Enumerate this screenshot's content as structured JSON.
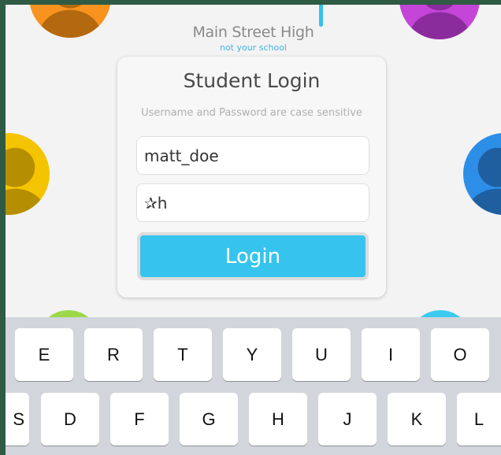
{
  "school": {
    "name": "Main Street High",
    "tagline": "not your school"
  },
  "login": {
    "title": "Student Login",
    "hint": "Username and Password are case sensitive",
    "username_value": "matt_doe",
    "password_value": "✰h",
    "button_label": "Login"
  },
  "keyboard": {
    "row1": [
      "E",
      "R",
      "T",
      "Y",
      "U",
      "I",
      "O"
    ],
    "row2": [
      "S",
      "D",
      "F",
      "G",
      "H",
      "J",
      "K",
      "L"
    ]
  },
  "colors": {
    "accent": "#36c4ef",
    "avatar_orange": "#f7931e",
    "avatar_purple": "#c445d8",
    "avatar_yellow": "#f5c400",
    "avatar_blue": "#2d8ee8",
    "avatar_green": "#9cd84a",
    "avatar_cyan": "#3fcaf0"
  }
}
